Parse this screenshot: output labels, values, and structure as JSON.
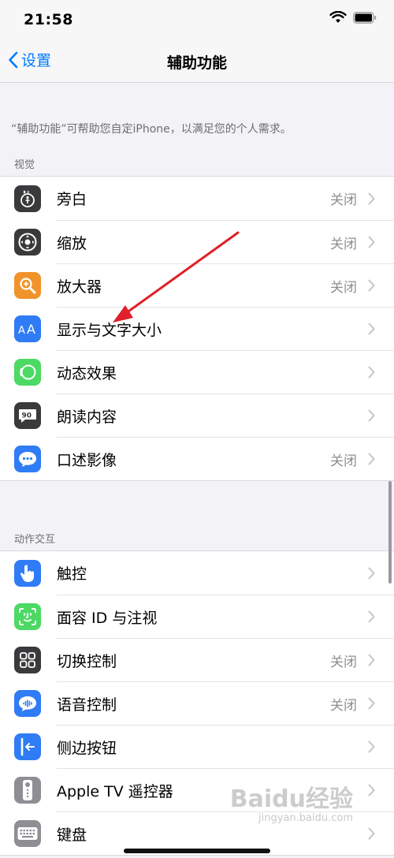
{
  "status_bar": {
    "time": "21:58"
  },
  "nav": {
    "back_label": "设置",
    "title": "辅助功能"
  },
  "description": "“辅助功能”可帮助您自定iPhone，以满足您的个人需求。",
  "sections": [
    {
      "header": "视觉",
      "items": [
        {
          "label": "旁白",
          "value": "关闭",
          "icon": "voiceover-icon",
          "color": "#3a3a3c"
        },
        {
          "label": "缩放",
          "value": "关闭",
          "icon": "zoom-icon",
          "color": "#3a3a3c"
        },
        {
          "label": "放大器",
          "value": "关闭",
          "icon": "magnifier-icon",
          "color": "#f0932b"
        },
        {
          "label": "显示与文字大小",
          "value": "",
          "icon": "text-size-icon",
          "color": "#2f7cf6"
        },
        {
          "label": "动态效果",
          "value": "",
          "icon": "motion-icon",
          "color": "#4cd964"
        },
        {
          "label": "朗读内容",
          "value": "",
          "icon": "spoken-content-icon",
          "color": "#3a3a3c"
        },
        {
          "label": "口述影像",
          "value": "关闭",
          "icon": "audio-description-icon",
          "color": "#2f7cf6"
        }
      ]
    },
    {
      "header": "动作交互",
      "items": [
        {
          "label": "触控",
          "value": "",
          "icon": "touch-icon",
          "color": "#2f7cf6"
        },
        {
          "label": "面容 ID 与注视",
          "value": "",
          "icon": "face-id-icon",
          "color": "#4cd964"
        },
        {
          "label": "切换控制",
          "value": "关闭",
          "icon": "switch-control-icon",
          "color": "#3a3a3c"
        },
        {
          "label": "语音控制",
          "value": "关闭",
          "icon": "voice-control-icon",
          "color": "#2f7cf6"
        },
        {
          "label": "侧边按钮",
          "value": "",
          "icon": "side-button-icon",
          "color": "#2f7cf6"
        },
        {
          "label": "Apple TV 遥控器",
          "value": "",
          "icon": "remote-icon",
          "color": "#8e8e93"
        },
        {
          "label": "键盘",
          "value": "",
          "icon": "keyboard-icon",
          "color": "#8e8e93"
        }
      ]
    }
  ],
  "watermark": {
    "text": "Baidu经验",
    "sub": "jingyan.baidu.com"
  },
  "colors": {
    "accent": "#007aff",
    "annotation": "#e0202a"
  }
}
